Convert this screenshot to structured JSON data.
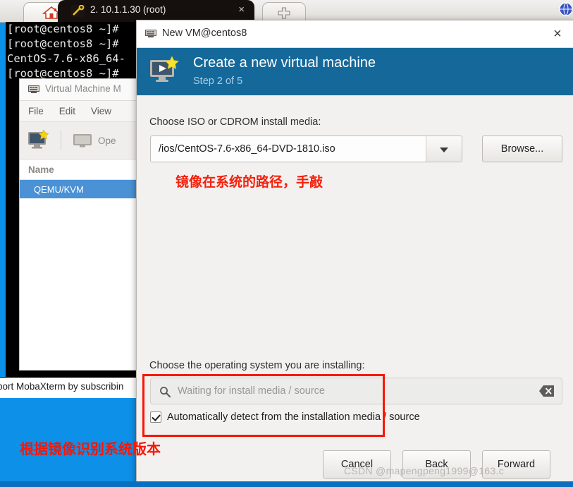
{
  "tabs": {
    "home_icon": "home-icon",
    "session": {
      "icon": "key-icon",
      "label": "2. 10.1.1.30 (root)",
      "close": "×"
    },
    "add": {
      "icon": "plus-icon"
    },
    "topright_icon": "globe-icon"
  },
  "terminal": {
    "lines": [
      "[root@centos8 ~]#",
      "[root@centos8 ~]#",
      "CentOS-7.6-x86_64-",
      "[root@centos8 ~]#"
    ],
    "status_strip": "port MobaXterm by subscribin"
  },
  "vmm": {
    "icon": "virt-manager-icon",
    "title": "Virtual Machine M",
    "menu": [
      "File",
      "Edit",
      "View"
    ],
    "toolbar": {
      "new_vm_icon": "new-vm-icon",
      "open_icon": "monitor-icon",
      "open_label": "Ope"
    },
    "column_header": "Name",
    "rows": [
      "QEMU/KVM"
    ]
  },
  "dialog": {
    "icon": "virt-manager-icon",
    "title": "New VM@centos8",
    "close": "×",
    "banner": {
      "icon": "new-vm-icon",
      "heading": "Create a new virtual machine",
      "step": "Step 2 of 5",
      "color": "#15699a"
    },
    "iso": {
      "label": "Choose ISO or CDROM install media:",
      "value": "/ios/CentOS-7.6-x86_64-DVD-1810.iso",
      "dropdown_icon": "chevron-down-icon",
      "browse_label": "Browse..."
    },
    "os": {
      "label": "Choose the operating system you are installing:",
      "search_icon": "search-icon",
      "search_value": "",
      "search_placeholder": "Waiting for install media / source",
      "clear_icon": "clear-icon",
      "checkbox_checked": true,
      "checkbox_label": "Automatically detect from the installation media / source"
    },
    "buttons": {
      "cancel": "Cancel",
      "back": "Back",
      "forward": "Forward"
    }
  },
  "annotations": {
    "note_iso_path": "镜像在系统的路径，手敲",
    "note_detect": "根据镜像识别系统版本",
    "highlight_color": "#fa1505",
    "watermark": "CSDN @mapengpeng1999@163.c"
  }
}
